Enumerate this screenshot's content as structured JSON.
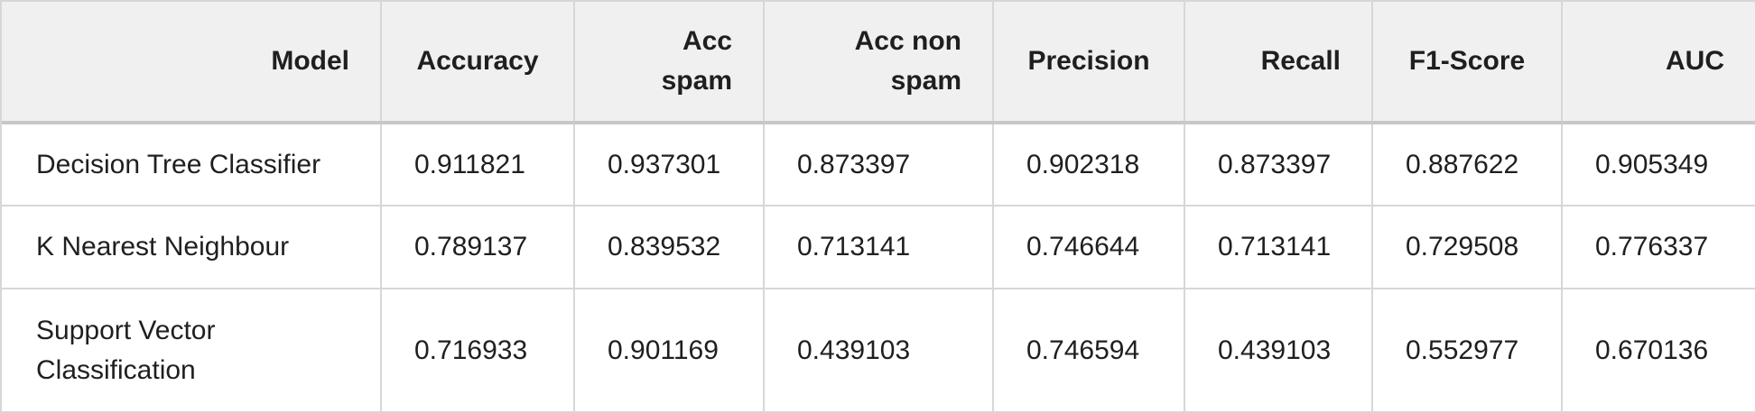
{
  "table": {
    "headers": [
      {
        "key": "model",
        "label": "Model"
      },
      {
        "key": "accuracy",
        "label": "Accuracy"
      },
      {
        "key": "acc_spam",
        "label": "Acc spam"
      },
      {
        "key": "acc_non_spam",
        "label": "Acc non spam"
      },
      {
        "key": "precision",
        "label": "Precision"
      },
      {
        "key": "recall",
        "label": "Recall"
      },
      {
        "key": "f1",
        "label": "F1-Score"
      },
      {
        "key": "auc",
        "label": "AUC"
      }
    ],
    "rows": [
      {
        "model": "Decision Tree Classifier",
        "accuracy": "0.911821",
        "acc_spam": "0.937301",
        "acc_non_spam": "0.873397",
        "precision": "0.902318",
        "recall": "0.873397",
        "f1": "0.887622",
        "auc": "0.905349"
      },
      {
        "model": "K Nearest Neighbour",
        "accuracy": "0.789137",
        "acc_spam": "0.839532",
        "acc_non_spam": "0.713141",
        "precision": "0.746644",
        "recall": "0.713141",
        "f1": "0.729508",
        "auc": "0.776337"
      },
      {
        "model": "Support Vector Classification",
        "accuracy": "0.716933",
        "acc_spam": "0.901169",
        "acc_non_spam": "0.439103",
        "precision": "0.746594",
        "recall": "0.439103",
        "f1": "0.552977",
        "auc": "0.670136"
      }
    ]
  }
}
